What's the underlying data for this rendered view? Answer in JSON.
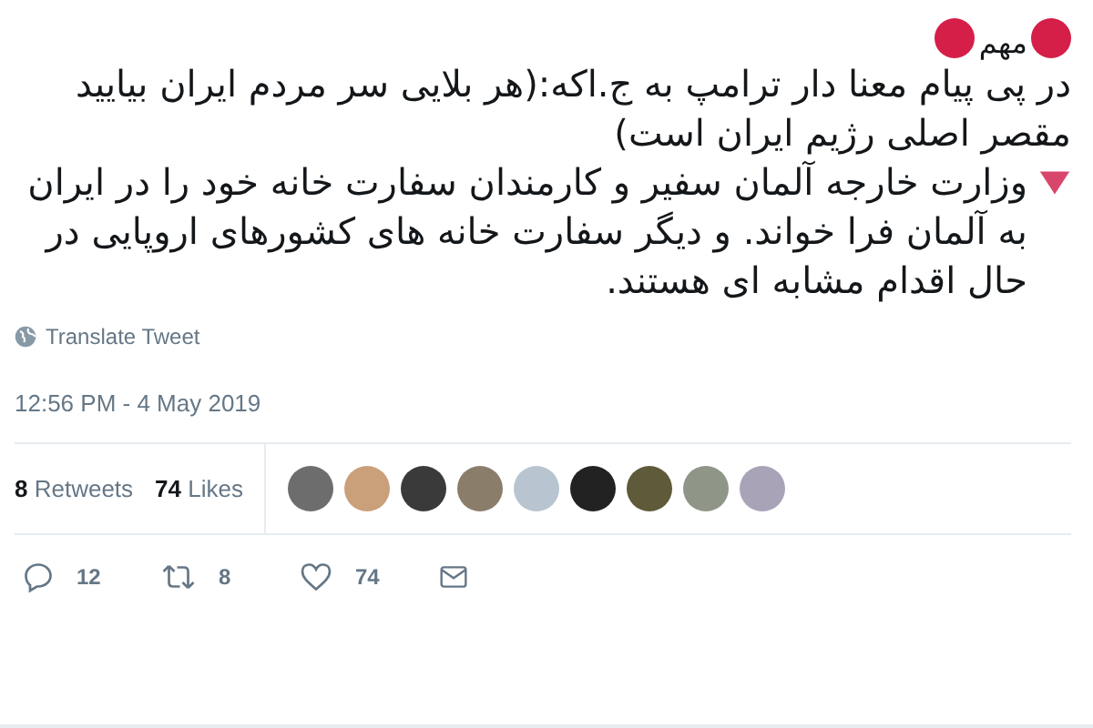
{
  "tweet": {
    "header": "مهم",
    "paragraphs": [
      "در پی پیام معنا دار ترامپ به ج.اکه:(هر بلایی سر مردم ایران بیایید مقصر اصلی رژیم ایران است)",
      "وزارت خارجه آلمان سفیر و کارمندان سفارت خانه خود را در ایران به آلمان فرا خواند. و دیگر سفارت خانه های کشورهای اروپایی در حال اقدام مشابه ای هستند."
    ],
    "translate": "Translate Tweet",
    "timestamp": "12:56 PM - 4 May 2019"
  },
  "stats": {
    "retweets_count": "8",
    "retweets_label": "Retweets",
    "likes_count": "74",
    "likes_label": "Likes"
  },
  "actions": {
    "replies": "12",
    "retweets": "8",
    "likes": "74"
  }
}
